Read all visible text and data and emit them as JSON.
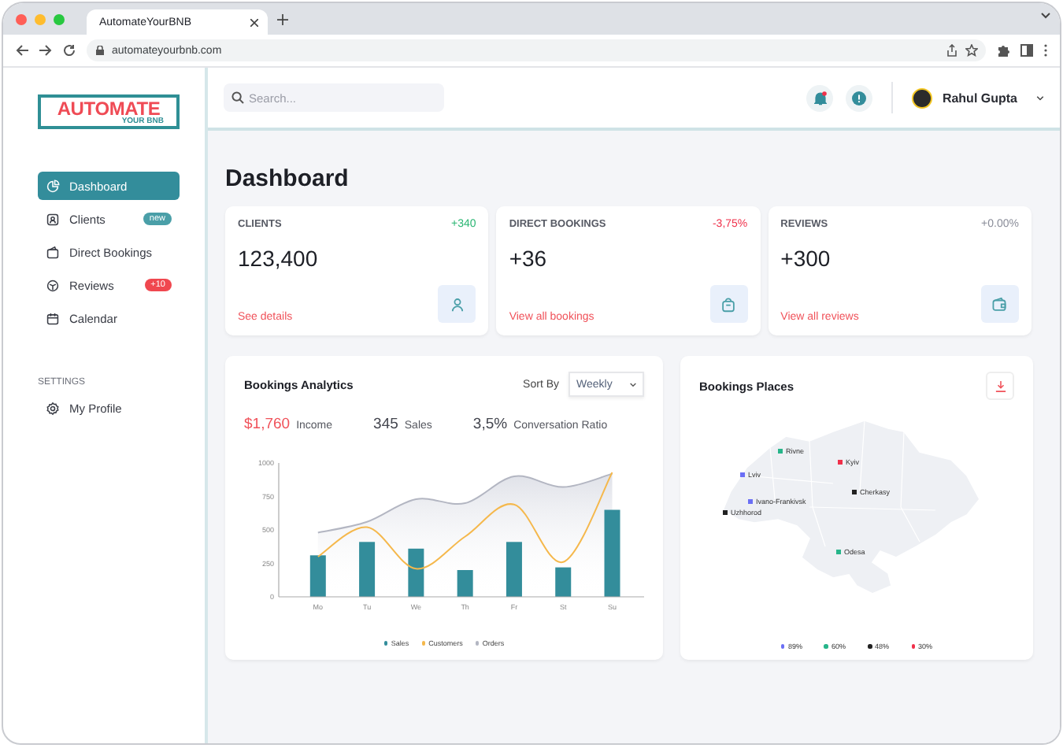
{
  "browser": {
    "tab_title": "AutomateYourBNB",
    "url": "automateyourbnb.com"
  },
  "logo": {
    "title": "AUTOMATE",
    "subtitle": "YOUR BNB"
  },
  "sidebar": {
    "items": [
      {
        "label": "Dashboard",
        "kind": "dashboard",
        "selected": true
      },
      {
        "label": "Clients",
        "kind": "clients",
        "selected": false,
        "badge": "new",
        "color": "#4a9fa8"
      },
      {
        "label": "Direct Bookings",
        "kind": "bookings",
        "selected": false
      },
      {
        "label": "Reviews",
        "kind": "reviews",
        "selected": false,
        "badge": "+10",
        "color": "#f0474f"
      },
      {
        "label": "Calendar",
        "kind": "calendar",
        "selected": false
      }
    ],
    "settings_heading": "SETTINGS",
    "settings_items": [
      {
        "label": "My Profile",
        "kind": "profile",
        "selected": false
      }
    ]
  },
  "header": {
    "search": {
      "placeholder": "Search..."
    },
    "notifications": {
      "unread": true
    },
    "user": {
      "name": "Rahul Gupta"
    }
  },
  "page_title": "Dashboard",
  "stat_cards": [
    {
      "title": "CLIENTS",
      "change": "+340",
      "color": "#2bb673",
      "value": "123,400",
      "link": "See details",
      "kind": "user"
    },
    {
      "title": "DIRECT BOOKINGS",
      "change": "-3,75%",
      "color": "#f0304a",
      "value": "+36",
      "link": "View all bookings",
      "kind": "bag"
    },
    {
      "title": "REVIEWS",
      "change": "+0.00%",
      "color": "#8a8d99",
      "value": "+300",
      "link": "View all reviews",
      "kind": "wallet"
    }
  ],
  "analytics": {
    "title": "Bookings Analytics",
    "sort_label": "Sort By",
    "sort_value": "Weekly",
    "metrics": [
      {
        "value": "$1,760",
        "label": "Income",
        "highlight": true
      },
      {
        "value": "345",
        "label": "Sales",
        "highlight": false
      },
      {
        "value": "3,5%",
        "label": "Conversation Ratio",
        "highlight": false
      }
    ],
    "chart_data": {
      "type": "bar",
      "legend": "bottom",
      "categories": [
        "Mo",
        "Tu",
        "We",
        "Th",
        "Fr",
        "St",
        "Su"
      ],
      "yticks": [
        {
          "value": 0,
          "label": "0"
        },
        {
          "value": 250,
          "label": "250"
        },
        {
          "value": 500,
          "label": "500"
        },
        {
          "value": 750,
          "label": "750"
        },
        {
          "value": 1000,
          "label": "1000"
        }
      ],
      "ylim": [
        0,
        1000
      ],
      "series": [
        {
          "name": "Sales",
          "color": "#338d9b",
          "values": [
            310,
            410,
            360,
            200,
            410,
            220,
            650
          ]
        },
        {
          "name": "Customers",
          "type": "line",
          "color": "#f5b84c",
          "values": [
            300,
            520,
            210,
            450,
            690,
            260,
            930
          ]
        },
        {
          "name": "Orders",
          "type": "area",
          "color": "#b3b6c2",
          "values": [
            480,
            560,
            730,
            700,
            900,
            820,
            920
          ]
        }
      ]
    }
  },
  "places": {
    "title": "Bookings Places",
    "cities": [
      {
        "name": "Rivne",
        "color": "#27b58a"
      },
      {
        "name": "Kyiv",
        "color": "#f0304a"
      },
      {
        "name": "Lviv",
        "color": "#6b6ff5"
      },
      {
        "name": "Cherkasy",
        "color": "#222222"
      },
      {
        "name": "Ivano-Frankivsk",
        "color": "#6b6ff5"
      },
      {
        "name": "Uzhhorod",
        "color": "#222222"
      },
      {
        "name": "Odesa",
        "color": "#27b58a"
      }
    ],
    "legend": [
      {
        "label": "89%",
        "color": "#6b6ff5"
      },
      {
        "label": "60%",
        "color": "#27b58a"
      },
      {
        "label": "48%",
        "color": "#222222"
      },
      {
        "label": "30%",
        "color": "#f0304a"
      }
    ]
  }
}
